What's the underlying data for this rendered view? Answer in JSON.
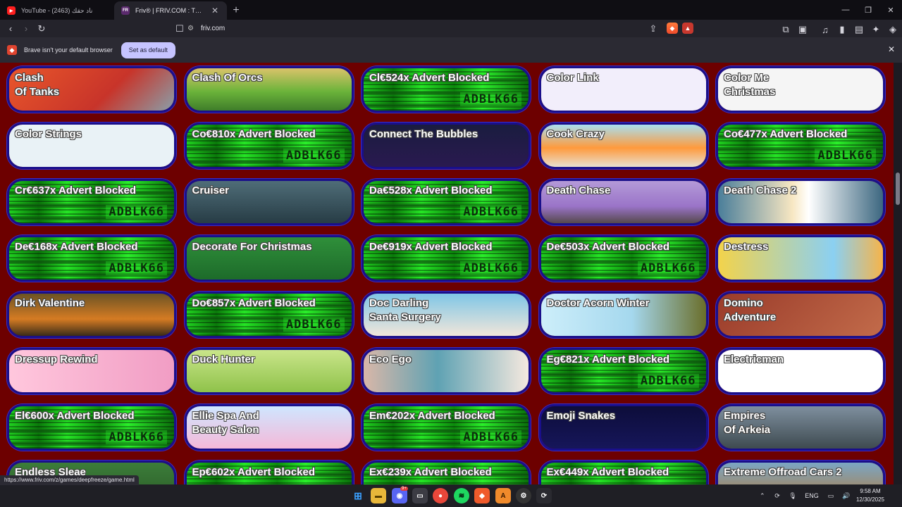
{
  "browser": {
    "tabs": [
      {
        "title": "YouTube - (2463) ناد حقك",
        "active": false,
        "icon": "youtube-icon"
      },
      {
        "title": "Friv® | FRIV.COM : The Best Free",
        "active": true,
        "icon": "friv-icon"
      }
    ],
    "url": "friv.com",
    "infobar": {
      "text": "Brave isn't your default browser",
      "button": "Set as default"
    },
    "status_url": "https://www.friv.com/z/games/deepfreeze/game.html"
  },
  "games": [
    {
      "label": "Clash\nOf Tanks",
      "art": "art-orange",
      "blocked": false
    },
    {
      "label": "Clash Of Orcs",
      "art": "art-orcs",
      "blocked": false
    },
    {
      "label": "Cl€524x Advert Blocked",
      "blocked": true
    },
    {
      "label": "Color Link",
      "art": "art-white",
      "blocked": false
    },
    {
      "label": "Color Me\nChristmas",
      "art": "art-colorme",
      "blocked": false
    },
    {
      "label": "Color Strings",
      "art": "art-strings",
      "blocked": false
    },
    {
      "label": "Co€810x Advert Blocked",
      "blocked": true
    },
    {
      "label": "Connect The Bubbles",
      "art": "art-bubbles",
      "blocked": false
    },
    {
      "label": "Cook Crazy",
      "art": "art-cook",
      "blocked": false
    },
    {
      "label": "Co€477x Advert Blocked",
      "blocked": true
    },
    {
      "label": "Cr€637x Advert Blocked",
      "blocked": true
    },
    {
      "label": "Cruiser",
      "art": "art-cruiser",
      "blocked": false
    },
    {
      "label": "Da€528x Advert Blocked",
      "blocked": true
    },
    {
      "label": "Death Chase",
      "art": "art-death",
      "blocked": false
    },
    {
      "label": "Death Chase 2",
      "art": "art-death2",
      "blocked": false
    },
    {
      "label": "De€168x Advert Blocked",
      "blocked": true
    },
    {
      "label": "Decorate For Christmas",
      "art": "art-xmas",
      "blocked": false
    },
    {
      "label": "De€919x Advert Blocked",
      "blocked": true
    },
    {
      "label": "De€503x Advert Blocked",
      "blocked": true
    },
    {
      "label": "Destress",
      "art": "art-destress",
      "blocked": false
    },
    {
      "label": "Dirk Valentine",
      "art": "art-dirk",
      "blocked": false
    },
    {
      "label": "Do€857x Advert Blocked",
      "blocked": true
    },
    {
      "label": "Doc Darling\nSanta Surgery",
      "art": "art-docd",
      "blocked": false
    },
    {
      "label": "Doctor Acorn Winter",
      "art": "art-acorn",
      "blocked": false
    },
    {
      "label": "Domino\nAdventure",
      "art": "art-domino",
      "blocked": false
    },
    {
      "label": "Dressup Rewind",
      "art": "art-dress",
      "blocked": false
    },
    {
      "label": "Duck Hunter",
      "art": "art-duck",
      "blocked": false
    },
    {
      "label": "Eco Ego",
      "art": "art-eco",
      "blocked": false
    },
    {
      "label": "Eg€821x Advert Blocked",
      "blocked": true
    },
    {
      "label": "Electricman",
      "art": "art-electric",
      "blocked": false
    },
    {
      "label": "El€600x Advert Blocked",
      "blocked": true
    },
    {
      "label": "Ellie Spa And\nBeauty Salon",
      "art": "art-ellie",
      "blocked": false
    },
    {
      "label": "Em€202x Advert Blocked",
      "blocked": true
    },
    {
      "label": "Emoji Snakes",
      "art": "art-emoji",
      "blocked": false
    },
    {
      "label": "Empires\nOf Arkeia",
      "art": "art-empires",
      "blocked": false
    },
    {
      "label": "Endless Sleae",
      "art": "art-sleigh",
      "blocked": false
    },
    {
      "label": "Ep€602x Advert Blocked",
      "blocked": true
    },
    {
      "label": "Ex€239x Advert Blocked",
      "blocked": true
    },
    {
      "label": "Ex€449x Advert Blocked",
      "blocked": true
    },
    {
      "label": "Extreme Offroad Cars 2",
      "art": "art-offroad",
      "blocked": false
    }
  ],
  "adblock_watermark": "ADBLK66",
  "taskbar": {
    "language": "ENG",
    "time": "9:58 AM",
    "date": "12/30/2025",
    "discord_badge": "9+"
  },
  "colors": {
    "page_background": "#6d0000",
    "card_border": "#1a0f8a",
    "infobar_button": "#c6c4ff"
  }
}
